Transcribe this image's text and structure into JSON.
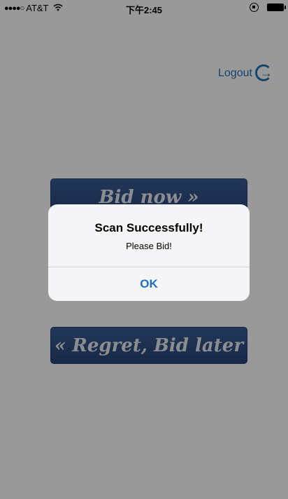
{
  "status_bar": {
    "signal": "●●●●○",
    "carrier": "AT&T",
    "time": "下午2:45"
  },
  "header": {
    "logout_label": "Logout"
  },
  "buttons": {
    "bid_now": "Bid now »",
    "bid_later": "« Regret, Bid later"
  },
  "alert": {
    "title": "Scan Successfully!",
    "message": "Please Bid!",
    "ok_label": "OK"
  },
  "colors": {
    "accent": "#1f72b8",
    "button_bg": "#2e4d82"
  }
}
